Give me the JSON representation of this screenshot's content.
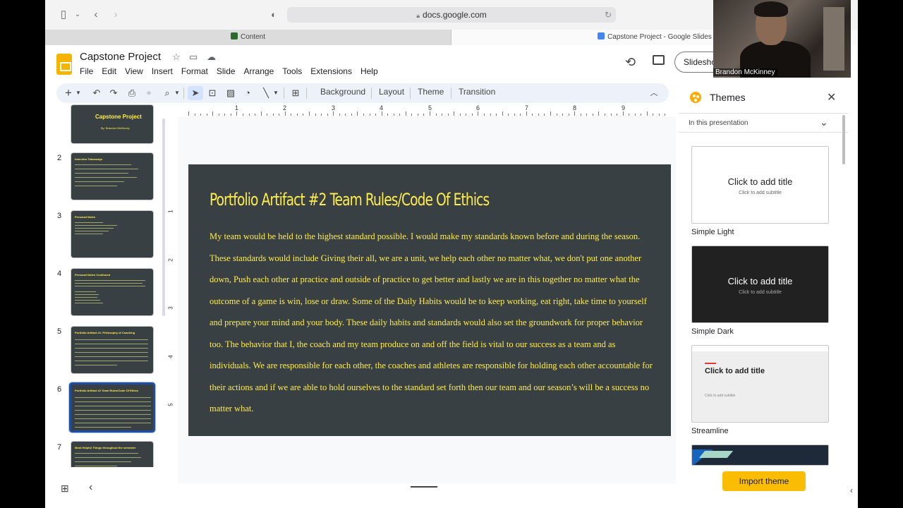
{
  "browser": {
    "url": "docs.google.com",
    "tabs": [
      {
        "label": "Content"
      },
      {
        "label": "Capstone Project - Google Slides"
      }
    ]
  },
  "doc": {
    "title": "Capstone Project",
    "menu": [
      "File",
      "Edit",
      "View",
      "Insert",
      "Format",
      "Slide",
      "Arrange",
      "Tools",
      "Extensions",
      "Help"
    ],
    "slideshow_label": "Slideshow"
  },
  "toolbar": {
    "background_label": "Background",
    "layout_label": "Layout",
    "theme_label": "Theme",
    "transition_label": "Transition"
  },
  "ruler": {
    "h_numbers": [
      "1",
      "2",
      "3",
      "4",
      "5",
      "6",
      "7",
      "8",
      "9"
    ],
    "v_numbers": [
      "1",
      "2",
      "3",
      "4",
      "5"
    ]
  },
  "filmstrip": {
    "slides": [
      {
        "num": "",
        "title": "Capstone Project",
        "subtitle": "By: Brandon McKinney"
      },
      {
        "num": "2",
        "title": "Interview Takeaways"
      },
      {
        "num": "3",
        "title": "Personal Notes"
      },
      {
        "num": "4",
        "title": "Personal Notes Continued"
      },
      {
        "num": "5",
        "title": "Portfolio Artifact #1: Philosophy of Coaching"
      },
      {
        "num": "6",
        "title": "Portfolio Artifact #2 Team Rules/Code Of Ethics"
      },
      {
        "num": "7",
        "title": "Most Helpful Things throughout the semester"
      }
    ]
  },
  "slide": {
    "title": "Portfolio Artifact #2 Team Rules/Code Of Ethics",
    "body": "My team would be held to the highest standard possible. I would make my standards known before and during the season. These standards would include Giving their all, we are a unit, we help each other no matter what, we don't put one another down, Push each other at practice and outside of practice to get better and lastly we are in this together no matter what the outcome of a game is win, lose or draw. Some of the Daily Habits would be to keep working, eat right, take time to yourself and prepare your mind and your body. These daily habits and standards would also set the groundwork for proper behavior too. The behavior that I, the coach and my team produce on and off the field is vital to our success as a team and as individuals. We are responsible for each other, the coaches and athletes are responsible for holding each other accountable for their actions and if we are able to hold ourselves to the standard set forth then our team and our season’s will be a success no matter what."
  },
  "themes": {
    "title": "Themes",
    "filter": "In this presentation",
    "items": [
      {
        "name": "Simple Light",
        "title": "Click to add title",
        "subtitle": "Click to add subtitle"
      },
      {
        "name": "Simple Dark",
        "title": "Click to add title",
        "subtitle": "Click to add subtitle"
      },
      {
        "name": "Streamline",
        "title": "Click to add title",
        "subtitle": "Click to add subtitle"
      }
    ],
    "import_label": "Import theme"
  },
  "webcam": {
    "name": "Brandon McKinney"
  },
  "colors": {
    "slide_bg": "#394044",
    "slide_text": "#ffed4f",
    "accent": "#fbbc04",
    "selection": "#1f4ea0"
  }
}
